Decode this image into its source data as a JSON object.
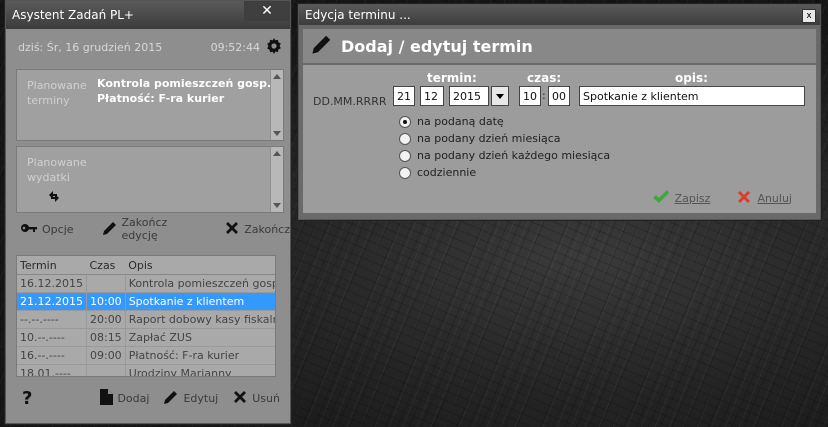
{
  "left_window": {
    "title": "Asystent Zadań PL+",
    "close_symbol": "✕",
    "date_text": "dziś: Śr, 16 grudzień 2015",
    "time_text": "09:52:44",
    "panel_planned": {
      "label": "Planowane terminy",
      "lines": [
        "Kontrola pomieszczeń gosp.",
        "Płatność: F-ra kurier"
      ]
    },
    "panel_expenses": {
      "label": "Planowane wydatki",
      "refresh_icon": "refresh-icon"
    },
    "toolbar": {
      "options": "Opcje",
      "finish_edit": "Zakończ edycję",
      "exit": "Zakończ"
    },
    "table": {
      "headers": [
        "Termin",
        "Czas",
        "Opis"
      ],
      "rows": [
        {
          "termin": "16.12.2015",
          "czas": "",
          "opis": "Kontrola pomieszczeń gosp."
        },
        {
          "termin": "21.12.2015",
          "czas": "10:00",
          "opis": "Spotkanie z klientem"
        },
        {
          "termin": "--.--.----",
          "czas": "20:00",
          "opis": "Raport dobowy kasy fiskalnej"
        },
        {
          "termin": "10.--.----",
          "czas": "08:15",
          "opis": "Zapłać ZUS"
        },
        {
          "termin": "16.--.----",
          "czas": "09:00",
          "opis": "Płatność: F-ra kurier"
        },
        {
          "termin": "18.01.----",
          "czas": "",
          "opis": "Urodziny Marianny"
        }
      ],
      "selected_index": 1
    },
    "bottom_toolbar": {
      "help": "?",
      "add": "Dodaj",
      "edit": "Edytuj",
      "delete": "Usuń"
    }
  },
  "right_window": {
    "title": "Edycja terminu ...",
    "close_symbol": "x",
    "heading": "Dodaj / edytuj termin",
    "col_termin": "termin:",
    "col_czas": "czas:",
    "col_opis": "opis:",
    "format_label": "DD.MM.RRRR",
    "day": "21",
    "month": "12",
    "year": "2015",
    "hour": "10",
    "minute": "00",
    "time_sep": ":",
    "description": "Spotkanie z klientem",
    "radios": [
      {
        "label": "na podaną datę",
        "checked": true
      },
      {
        "label": "na podany dzień miesiąca",
        "checked": false
      },
      {
        "label": "na podany dzień każdego miesiąca",
        "checked": false
      },
      {
        "label": "codziennie",
        "checked": false
      }
    ],
    "save": "Zapisz",
    "cancel": "Anuluj"
  },
  "colors": {
    "selection": "#3399ff",
    "save_green": "#3fa83a",
    "cancel_red": "#e03a2a"
  }
}
